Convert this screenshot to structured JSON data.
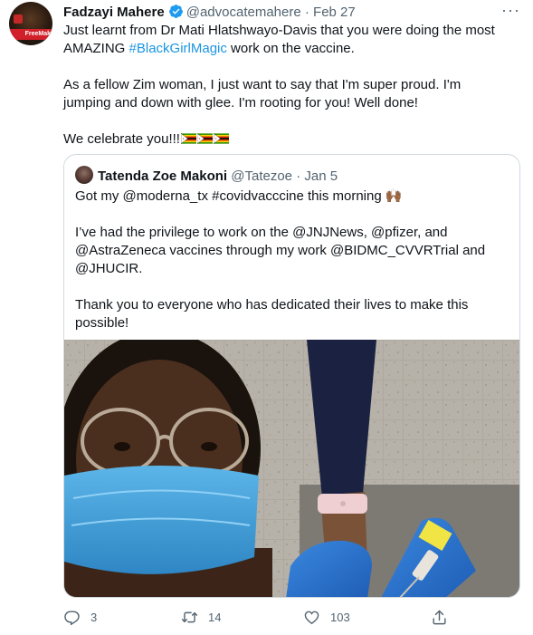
{
  "tweet": {
    "author_name": "Fadzayi Mahere",
    "handle": "@advocatemahere",
    "separator": "·",
    "date": "Feb 27",
    "more": "···",
    "avatar_badge": "FreeMak",
    "line1": "Just learnt from Dr Mati Hlatshwayo-Davis that you were doing the most",
    "line2_prefix": "AMAZING ",
    "hashtag": "#BlackGirlMagic",
    "line2_suffix": " work on the vaccine.",
    "para2_line1": "As a fellow Zim woman, I just want to say that I'm super proud. I'm",
    "para2_line2": "jumping and down with glee. I'm rooting for you! Well done!",
    "para3": "We celebrate you!!!"
  },
  "quote": {
    "author_name": "Tatenda Zoe Makoni",
    "handle": "@Tatezoe",
    "separator": "·",
    "date": "Jan 5",
    "line1": "Got my  @moderna_tx #covidvacccine this morning 🙌🏾",
    "line2": "I’ve had the privilege to work on the @JNJNews, @pfizer, and",
    "line3": "@AstraZeneca vaccines through my work @BIDMC_CVVRTrial and",
    "line4": "@JHUCIR.",
    "line5": "Thank you to everyone who has dedicated their lives to make this",
    "line6": "possible!"
  },
  "actions": {
    "reply_count": "3",
    "retweet_count": "14",
    "like_count": "103"
  },
  "colors": {
    "link": "#1b95e0",
    "secondary_text": "#536471",
    "verified": "#1d9bf0"
  },
  "icons": [
    "verified-badge-icon",
    "more-icon",
    "reply-icon",
    "retweet-icon",
    "like-icon",
    "share-icon",
    "zimbabwe-flag-icon"
  ]
}
